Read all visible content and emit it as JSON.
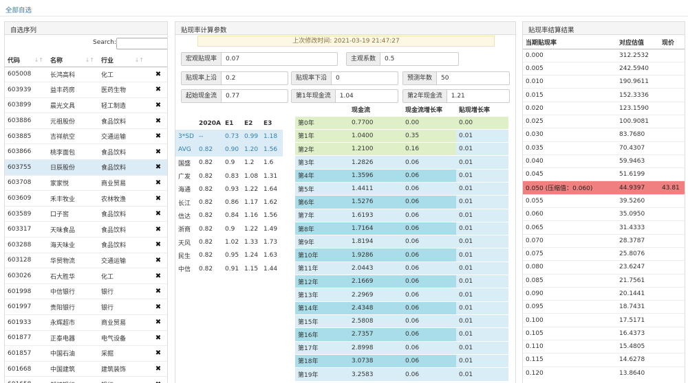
{
  "topbar": {
    "link": "全部自选"
  },
  "left": {
    "title": "自选序列",
    "search_label": "Search:",
    "search_value": "",
    "columns": [
      "代码",
      "名称",
      "行业"
    ],
    "sort_glyph": "↓↑",
    "delete_glyph": "✖",
    "rows": [
      {
        "code": "605008",
        "name": "长鸿高科",
        "industry": "化工"
      },
      {
        "code": "603939",
        "name": "益丰药房",
        "industry": "医药生物"
      },
      {
        "code": "603899",
        "name": "晨光文具",
        "industry": "轻工制造"
      },
      {
        "code": "603886",
        "name": "元祖股份",
        "industry": "食品饮料"
      },
      {
        "code": "603885",
        "name": "吉祥航空",
        "industry": "交通运输"
      },
      {
        "code": "603866",
        "name": "桃李面包",
        "industry": "食品饮料"
      },
      {
        "code": "603755",
        "name": "日辰股份",
        "industry": "食品饮料"
      },
      {
        "code": "603708",
        "name": "家家悦",
        "industry": "商业贸易"
      },
      {
        "code": "603609",
        "name": "禾丰牧业",
        "industry": "农林牧渔"
      },
      {
        "code": "603589",
        "name": "口子窖",
        "industry": "食品饮料"
      },
      {
        "code": "603317",
        "name": "天味食品",
        "industry": "食品饮料"
      },
      {
        "code": "603288",
        "name": "海天味业",
        "industry": "食品饮料"
      },
      {
        "code": "603128",
        "name": "华贸物流",
        "industry": "交通运输"
      },
      {
        "code": "603026",
        "name": "石大胜华",
        "industry": "化工"
      },
      {
        "code": "601998",
        "name": "中信银行",
        "industry": "银行"
      },
      {
        "code": "601997",
        "name": "贵阳银行",
        "industry": "银行"
      },
      {
        "code": "601933",
        "name": "永辉超市",
        "industry": "商业贸易"
      },
      {
        "code": "601877",
        "name": "正泰电器",
        "industry": "电气设备"
      },
      {
        "code": "601857",
        "name": "中国石油",
        "industry": "采掘"
      },
      {
        "code": "601668",
        "name": "中国建筑",
        "industry": "建筑装饰"
      },
      {
        "code": "601658",
        "name": "邮储银行",
        "industry": "银行"
      }
    ]
  },
  "mid": {
    "title": "贴现率计算参数",
    "modtime": "上次修改时间: 2021-03-19 21:47:27",
    "params": {
      "macro_rate": {
        "label": "宏观贴现率",
        "value": "0.07"
      },
      "subject_coef": {
        "label": "主观系数",
        "value": "0.5"
      },
      "rate_upper": {
        "label": "贴现率上沿",
        "value": "0.2"
      },
      "rate_lower": {
        "label": "贴现率下沿",
        "value": "0"
      },
      "forecast_years": {
        "label": "预测年数",
        "value": "50"
      },
      "start_cf": {
        "label": "起始现金流",
        "value": "0.77"
      },
      "cf_y1": {
        "label": "第1年现金流",
        "value": "1.04"
      },
      "cf_y2": {
        "label": "第2年现金流",
        "value": "1.21"
      }
    },
    "eps": {
      "columns": [
        "",
        "2020A",
        "E1",
        "E2",
        "E3"
      ],
      "rows": [
        {
          "name": "3*SD",
          "v": [
            "--",
            "0.73",
            "0.99",
            "1.18"
          ],
          "hl": true
        },
        {
          "name": "AVG",
          "v": [
            "0.82",
            "0.90",
            "1.20",
            "1.56"
          ],
          "hl": true
        },
        {
          "name": "国盛",
          "v": [
            "0.82",
            "0.9",
            "1.2",
            "1.6"
          ]
        },
        {
          "name": "广发",
          "v": [
            "0.82",
            "0.83",
            "1.08",
            "1.31"
          ]
        },
        {
          "name": "海通",
          "v": [
            "0.82",
            "0.93",
            "1.22",
            "1.64"
          ]
        },
        {
          "name": "长江",
          "v": [
            "0.82",
            "0.86",
            "1.17",
            "1.62"
          ]
        },
        {
          "name": "信达",
          "v": [
            "0.82",
            "0.84",
            "1.16",
            "1.56"
          ]
        },
        {
          "name": "浙商",
          "v": [
            "0.82",
            "0.9",
            "1.22",
            "1.49"
          ]
        },
        {
          "name": "天风",
          "v": [
            "0.82",
            "1.02",
            "1.33",
            "1.73"
          ]
        },
        {
          "name": "民生",
          "v": [
            "0.82",
            "0.95",
            "1.24",
            "1.63"
          ]
        },
        {
          "name": "中信",
          "v": [
            "0.82",
            "0.91",
            "1.15",
            "1.44"
          ]
        }
      ]
    },
    "cashflow": {
      "columns": [
        "",
        "现金流",
        "现金流增长率",
        "贴现增长率"
      ],
      "rows": [
        {
          "year": "第0年",
          "cf": "0.7700",
          "growth": "0.00",
          "rate": "0.00",
          "style": "g",
          "rate_green": true
        },
        {
          "year": "第1年",
          "cf": "1.0400",
          "growth": "0.35",
          "rate": "0.01",
          "style": "g"
        },
        {
          "year": "第2年",
          "cf": "1.2100",
          "growth": "0.16",
          "rate": "0.01",
          "style": "g"
        },
        {
          "year": "第3年",
          "cf": "1.2826",
          "growth": "0.06",
          "rate": "0.01",
          "style": "lb"
        },
        {
          "year": "第4年",
          "cf": "1.3596",
          "growth": "0.06",
          "rate": "0.01",
          "style": "b"
        },
        {
          "year": "第5年",
          "cf": "1.4411",
          "growth": "0.06",
          "rate": "0.01",
          "style": "lb"
        },
        {
          "year": "第6年",
          "cf": "1.5276",
          "growth": "0.06",
          "rate": "0.01",
          "style": "b"
        },
        {
          "year": "第7年",
          "cf": "1.6193",
          "growth": "0.06",
          "rate": "0.01",
          "style": "lb"
        },
        {
          "year": "第8年",
          "cf": "1.7164",
          "growth": "0.06",
          "rate": "0.01",
          "style": "b"
        },
        {
          "year": "第9年",
          "cf": "1.8194",
          "growth": "0.06",
          "rate": "0.01",
          "style": "lb"
        },
        {
          "year": "第10年",
          "cf": "1.9286",
          "growth": "0.06",
          "rate": "0.01",
          "style": "b"
        },
        {
          "year": "第11年",
          "cf": "2.0443",
          "growth": "0.06",
          "rate": "0.01",
          "style": "lb"
        },
        {
          "year": "第12年",
          "cf": "2.1669",
          "growth": "0.06",
          "rate": "0.01",
          "style": "b"
        },
        {
          "year": "第13年",
          "cf": "2.2969",
          "growth": "0.06",
          "rate": "0.01",
          "style": "lb"
        },
        {
          "year": "第14年",
          "cf": "2.4348",
          "growth": "0.06",
          "rate": "0.01",
          "style": "b"
        },
        {
          "year": "第15年",
          "cf": "2.5808",
          "growth": "0.06",
          "rate": "0.01",
          "style": "lb"
        },
        {
          "year": "第16年",
          "cf": "2.7357",
          "growth": "0.06",
          "rate": "0.01",
          "style": "b"
        },
        {
          "year": "第17年",
          "cf": "2.8998",
          "growth": "0.06",
          "rate": "0.01",
          "style": "lb"
        },
        {
          "year": "第18年",
          "cf": "3.0738",
          "growth": "0.06",
          "rate": "0.01",
          "style": "b"
        },
        {
          "year": "第19年",
          "cf": "3.2583",
          "growth": "0.06",
          "rate": "0.01",
          "style": "lb"
        }
      ]
    }
  },
  "right": {
    "title": "贴现率结算结果",
    "columns": [
      "当期贴现率",
      "对应估值",
      "现价"
    ],
    "rows": [
      {
        "rate": "0.000",
        "val": "312.2532",
        "price": ""
      },
      {
        "rate": "0.005",
        "val": "242.5940",
        "price": ""
      },
      {
        "rate": "0.010",
        "val": "190.9611",
        "price": ""
      },
      {
        "rate": "0.015",
        "val": "152.3336",
        "price": ""
      },
      {
        "rate": "0.020",
        "val": "123.1590",
        "price": ""
      },
      {
        "rate": "0.025",
        "val": "100.9081",
        "price": ""
      },
      {
        "rate": "0.030",
        "val": "83.7680",
        "price": ""
      },
      {
        "rate": "0.035",
        "val": "70.4307",
        "price": ""
      },
      {
        "rate": "0.040",
        "val": "59.9463",
        "price": ""
      },
      {
        "rate": "0.045",
        "val": "51.6199",
        "price": ""
      },
      {
        "rate": "0.050 (压缩值：0.060)",
        "val": "44.9397",
        "price": "43.81",
        "hot": true
      },
      {
        "rate": "0.055",
        "val": "39.5260",
        "price": ""
      },
      {
        "rate": "0.060",
        "val": "35.0950",
        "price": ""
      },
      {
        "rate": "0.065",
        "val": "31.4333",
        "price": ""
      },
      {
        "rate": "0.070",
        "val": "28.3787",
        "price": ""
      },
      {
        "rate": "0.075",
        "val": "25.8076",
        "price": ""
      },
      {
        "rate": "0.080",
        "val": "23.6247",
        "price": ""
      },
      {
        "rate": "0.085",
        "val": "21.7561",
        "price": ""
      },
      {
        "rate": "0.090",
        "val": "20.1441",
        "price": ""
      },
      {
        "rate": "0.095",
        "val": "18.7431",
        "price": ""
      },
      {
        "rate": "0.100",
        "val": "17.5171",
        "price": ""
      },
      {
        "rate": "0.105",
        "val": "16.4373",
        "price": ""
      },
      {
        "rate": "0.110",
        "val": "15.4805",
        "price": ""
      },
      {
        "rate": "0.115",
        "val": "14.6278",
        "price": ""
      },
      {
        "rate": "0.120",
        "val": "13.8640",
        "price": ""
      }
    ]
  }
}
